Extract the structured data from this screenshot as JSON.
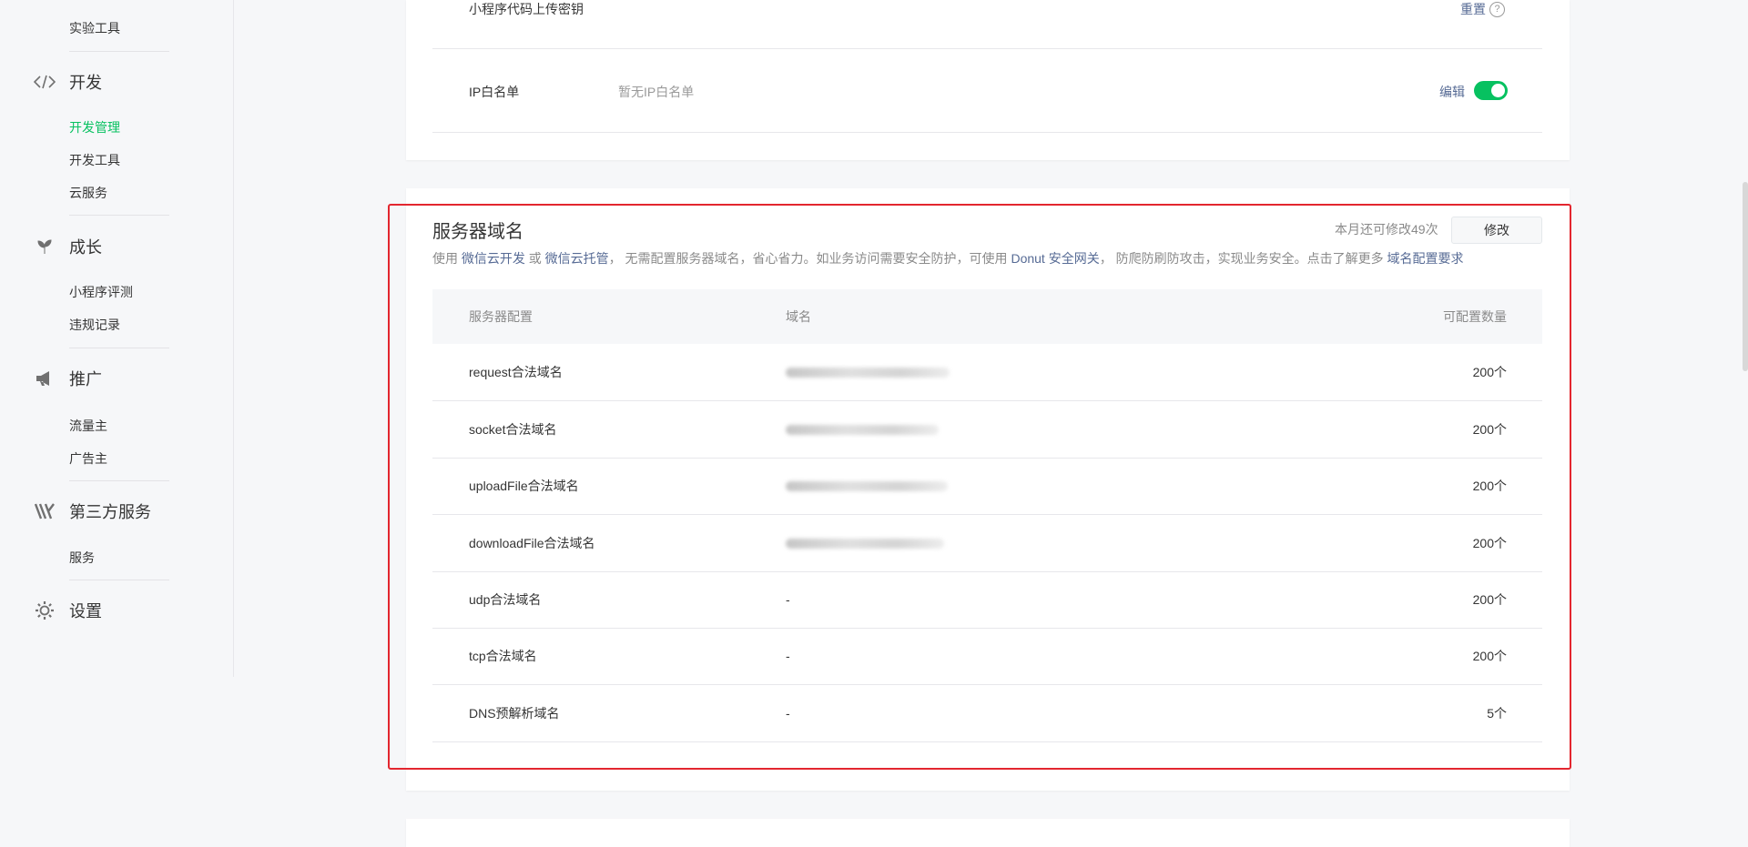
{
  "sidebar": {
    "partial_top_item": "实验工具",
    "sections": [
      {
        "icon": "code-icon",
        "label": "开发",
        "items": [
          "开发管理",
          "开发工具",
          "云服务"
        ],
        "active": "开发管理"
      },
      {
        "icon": "leaf-icon",
        "label": "成长",
        "items": [
          "小程序评测",
          "违规记录"
        ]
      },
      {
        "icon": "megaphone-icon",
        "label": "推广",
        "items": [
          "流量主",
          "广告主"
        ]
      },
      {
        "icon": "third-party-icon",
        "label": "第三方服务",
        "items": [
          "服务"
        ]
      },
      {
        "icon": "gear-icon",
        "label": "设置",
        "items": []
      }
    ]
  },
  "top_card": {
    "upload_key_label": "小程序代码上传密钥",
    "reset_link": "重置",
    "ip_label": "IP白名单",
    "ip_value": "暂无IP白名单",
    "edit_link": "编辑",
    "toggle_on": true
  },
  "server_domain": {
    "title": "服务器域名",
    "remaining": "本月还可修改49次",
    "modify_button": "修改",
    "desc": {
      "p1": "使用 ",
      "link1": "微信云开发",
      "p2": " 或 ",
      "link2": "微信云托管",
      "p3": "， 无需配置服务器域名，省心省力。如业务访问需要安全防护，可使用 ",
      "link3": "Donut 安全网关",
      "p4": "， 防爬防刷防攻击，实现业务安全。点击了解更多 ",
      "link4": "域名配置要求"
    },
    "columns": [
      "服务器配置",
      "域名",
      "可配置数量"
    ],
    "rows": [
      {
        "name": "request合法域名",
        "domain": "",
        "count": "200个"
      },
      {
        "name": "socket合法域名",
        "domain": "",
        "count": "200个"
      },
      {
        "name": "uploadFile合法域名",
        "domain": "",
        "count": "200个"
      },
      {
        "name": "downloadFile合法域名",
        "domain": "",
        "count": "200个"
      },
      {
        "name": "udp合法域名",
        "domain": "-",
        "count": "200个"
      },
      {
        "name": "tcp合法域名",
        "domain": "-",
        "count": "200个"
      },
      {
        "name": "DNS预解析域名",
        "domain": "-",
        "count": "5个"
      }
    ]
  },
  "colors": {
    "accent": "#07c160",
    "link": "#576b95",
    "highlight": "#e3262f"
  }
}
